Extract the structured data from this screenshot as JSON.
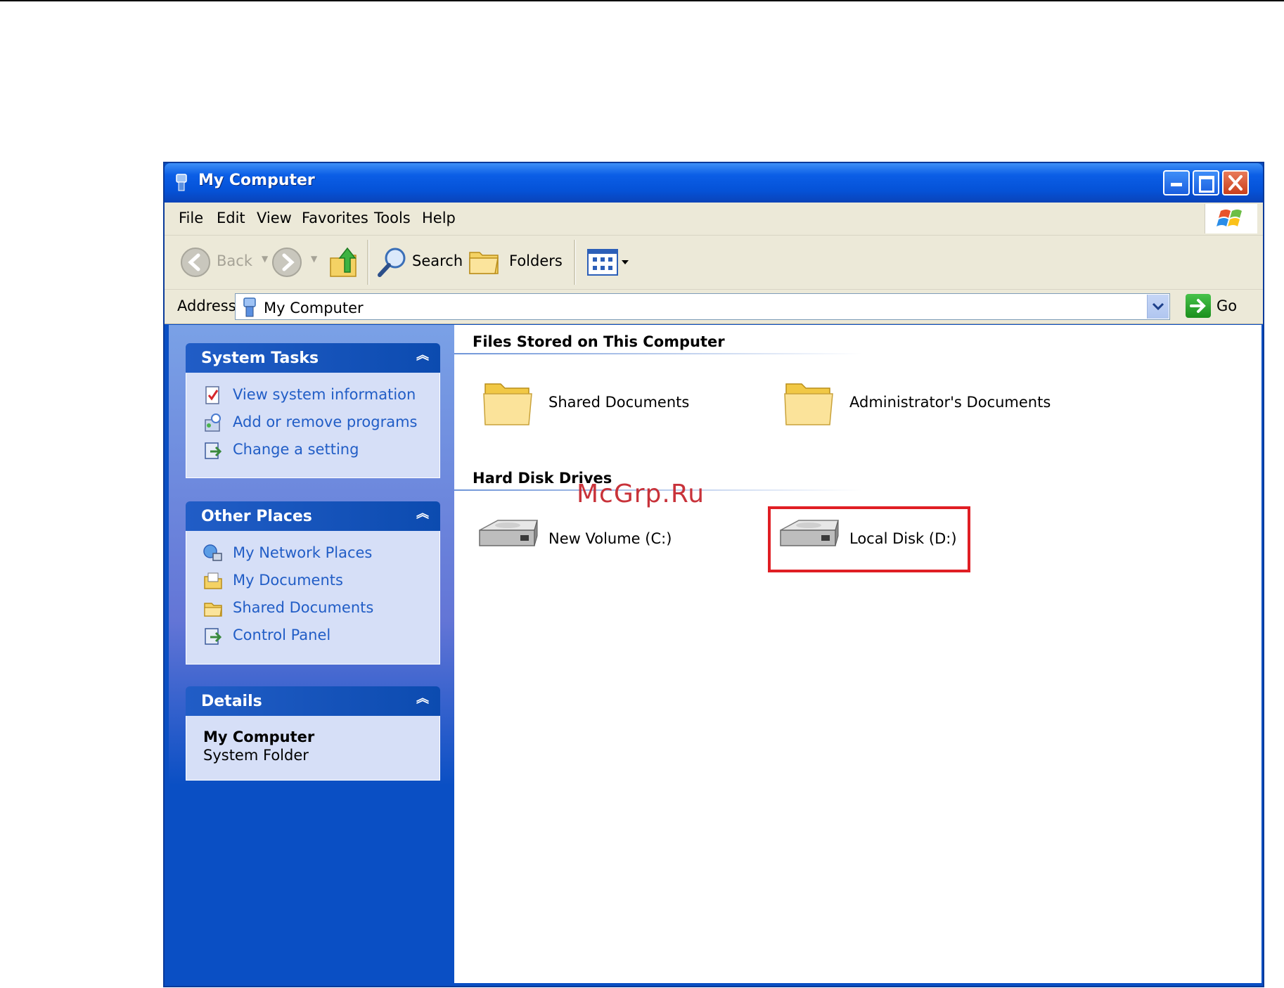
{
  "window": {
    "title": "My Computer"
  },
  "menu": [
    "File",
    "Edit",
    "View",
    "Favorites",
    "Tools",
    "Help"
  ],
  "toolbar": {
    "back_label": "Back",
    "search_label": "Search",
    "folders_label": "Folders"
  },
  "address": {
    "label": "Address",
    "value": "My Computer",
    "go_label": "Go"
  },
  "system_tasks": {
    "title": "System Tasks",
    "items": [
      {
        "label": "View system information",
        "icon": "system-info-icon"
      },
      {
        "label": "Add or remove programs",
        "icon": "add-remove-programs-icon"
      },
      {
        "label": "Change a setting",
        "icon": "control-panel-icon"
      }
    ]
  },
  "other_places": {
    "title": "Other Places",
    "items": [
      {
        "label": "My Network Places",
        "icon": "network-places-icon"
      },
      {
        "label": "My Documents",
        "icon": "my-documents-icon"
      },
      {
        "label": "Shared Documents",
        "icon": "shared-folder-icon"
      },
      {
        "label": "Control Panel",
        "icon": "control-panel-icon"
      }
    ]
  },
  "details": {
    "title": "Details",
    "name": "My Computer",
    "type": "System Folder"
  },
  "files_group": {
    "title": "Files Stored on This Computer",
    "items": [
      "Shared Documents",
      "Administrator's Documents"
    ]
  },
  "drives_group": {
    "title": "Hard Disk Drives",
    "items": [
      "New Volume (C:)",
      "Local Disk (D:)"
    ]
  },
  "watermark": "McGrp.Ru",
  "colors": {
    "title_bar": "#0552d7",
    "task_pane": "#0a4fc4",
    "task_link": "#215dc6",
    "highlight": "#e01e24"
  }
}
